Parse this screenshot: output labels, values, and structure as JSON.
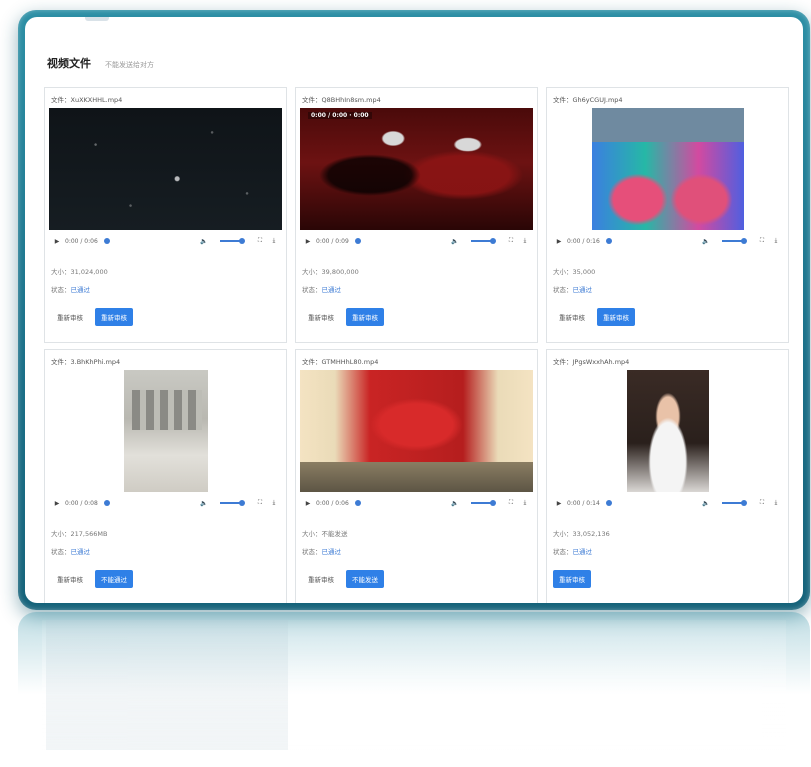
{
  "header": {
    "title": "视频文件",
    "subtitle": "不能发送给对方"
  },
  "cards": [
    {
      "filename": "文件：XuXKXHHL.mp4",
      "video_frame": "night-sky",
      "video_tag": "",
      "time": "0:00 / 0:06",
      "size": "大小：31,024,000",
      "status_label": "状态：",
      "status_value": "已通过",
      "secondary_button": "重新审核",
      "primary_button": "重新审核"
    },
    {
      "filename": "文件：Q8BHhIn8sm.mp4",
      "video_frame": "red-room",
      "video_tag": "0:00 / 0:00 · 0:00",
      "time": "0:00 / 0:09",
      "size": "大小：39,800,000",
      "status_label": "状态：",
      "status_value": "已通过",
      "secondary_button": "重新审核",
      "primary_button": "重新审核"
    },
    {
      "filename": "文件：Gh6yCGUJ.mp4",
      "video_frame": "concert",
      "video_tag": "",
      "time": "0:00 / 0:16",
      "size": "大小：35,000",
      "status_label": "状态：",
      "status_value": "已通过",
      "secondary_button": "重新审核",
      "primary_button": "重新审核"
    },
    {
      "filename": "文件：3.BhKhPhi.mp4",
      "video_frame": "snow-street",
      "video_tag": "",
      "time": "0:00 / 0:08",
      "size": "大小：217,566MB",
      "status_label": "状态：",
      "status_value": "已通过",
      "secondary_button": "重新审核",
      "primary_button": "不能通过"
    },
    {
      "filename": "文件：GTMHHhL80.mp4",
      "video_frame": "corridor",
      "video_tag": "",
      "time": "0:00 / 0:06",
      "size": "大小：不能发送",
      "status_label": "状态：",
      "status_value": "已通过",
      "secondary_button": "重新审核",
      "primary_button": "不能发送"
    },
    {
      "filename": "文件：JPgsWxxhAh.mp4",
      "video_frame": "selfie",
      "video_tag": "",
      "time": "0:00 / 0:14",
      "size": "大小：33,052,136",
      "status_label": "状态：",
      "status_value": "已通过",
      "secondary_button": "",
      "primary_button": "重新审核"
    }
  ]
}
